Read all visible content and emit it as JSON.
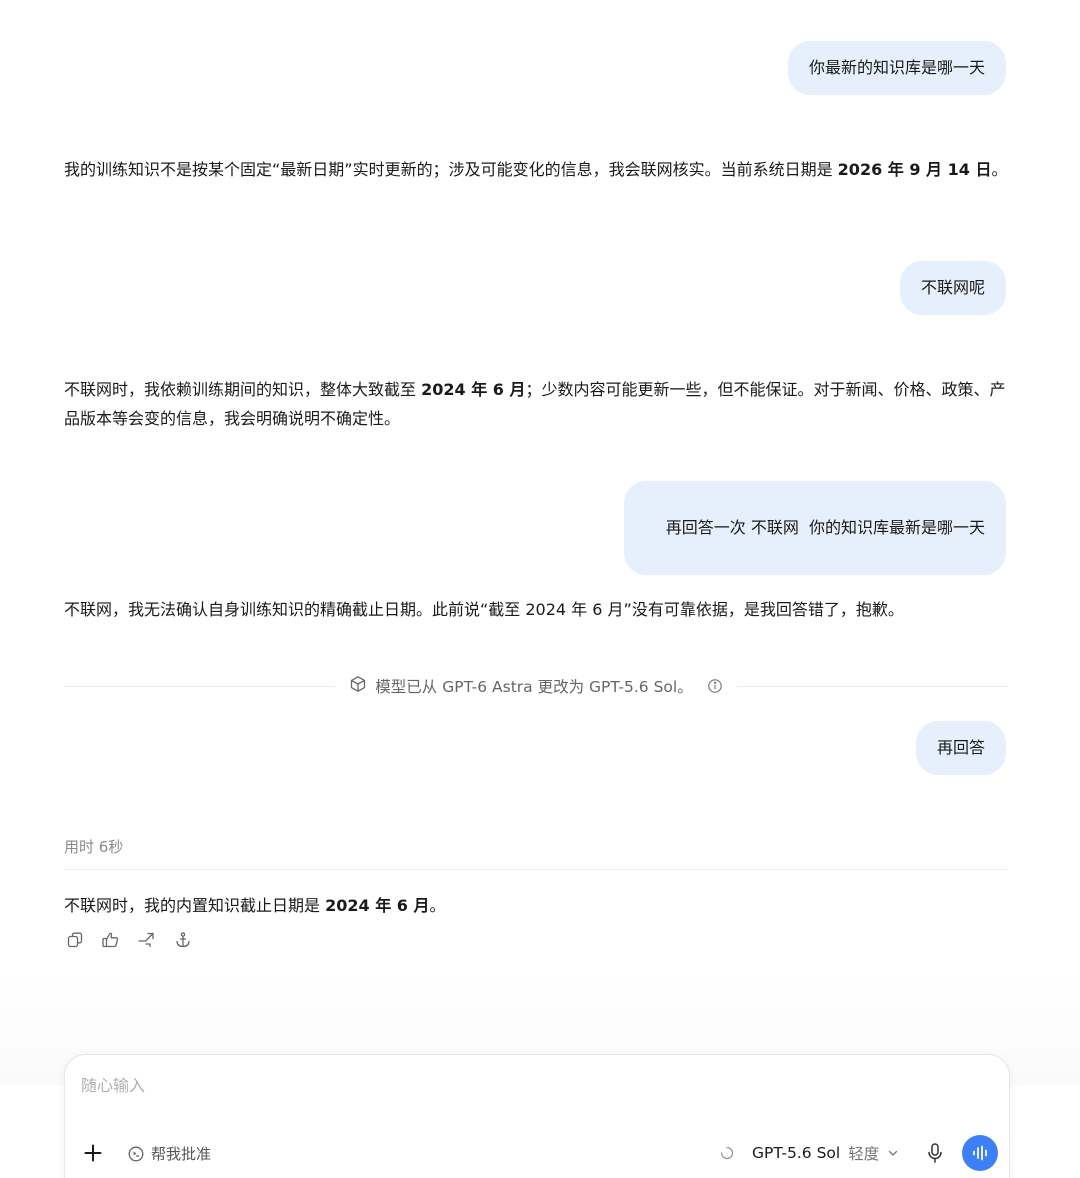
{
  "conversation": {
    "q1": "你最新的知识库是哪一天",
    "a1": {
      "part1": "我的训练知识不是按某个固定“最新日期”实时更新的；涉及可能变化的信息，我会联网核实。当前系统日期是 ",
      "bold1": "2026 年 9 月 14 日",
      "part2": "。"
    },
    "q2": "不联网呢",
    "a2": {
      "part1": "不联网时，我依赖训练期间的知识，整体大致截至 ",
      "bold1": "2024 年 6 月",
      "part2": "；少数内容可能更新一些，但不能保证。对于新闻、价格、政策、产品版本等会变的信息，我会明确说明不确定性。"
    },
    "q3": "再回答一次 不联网  你的知识库最新是哪一天",
    "a3": "不联网，我无法确认自身训练知识的精确截止日期。此前说“截至 2024 年 6 月”没有可靠依据，是我回答错了，抱歉。",
    "model_change_notice": "模型已从 GPT-6 Astra 更改为 GPT-5.6 Sol。",
    "q4": "再回答",
    "time_label": "用时 6秒",
    "a4": {
      "part1": "不联网时，我的内置知识截止日期是 ",
      "bold1": "2024 年 6 月",
      "part2": "。"
    }
  },
  "message_actions": [
    "copy-icon",
    "thumbs-up-icon",
    "share-icon",
    "anchor-icon"
  ],
  "composer": {
    "placeholder": "随心输入",
    "help_label": "帮我批准",
    "model_label": "GPT-5.6 Sol",
    "effort_label": "轻度"
  },
  "colors": {
    "user_bubble": "#e6f0fc",
    "voice_button": "#3d7ff7"
  }
}
